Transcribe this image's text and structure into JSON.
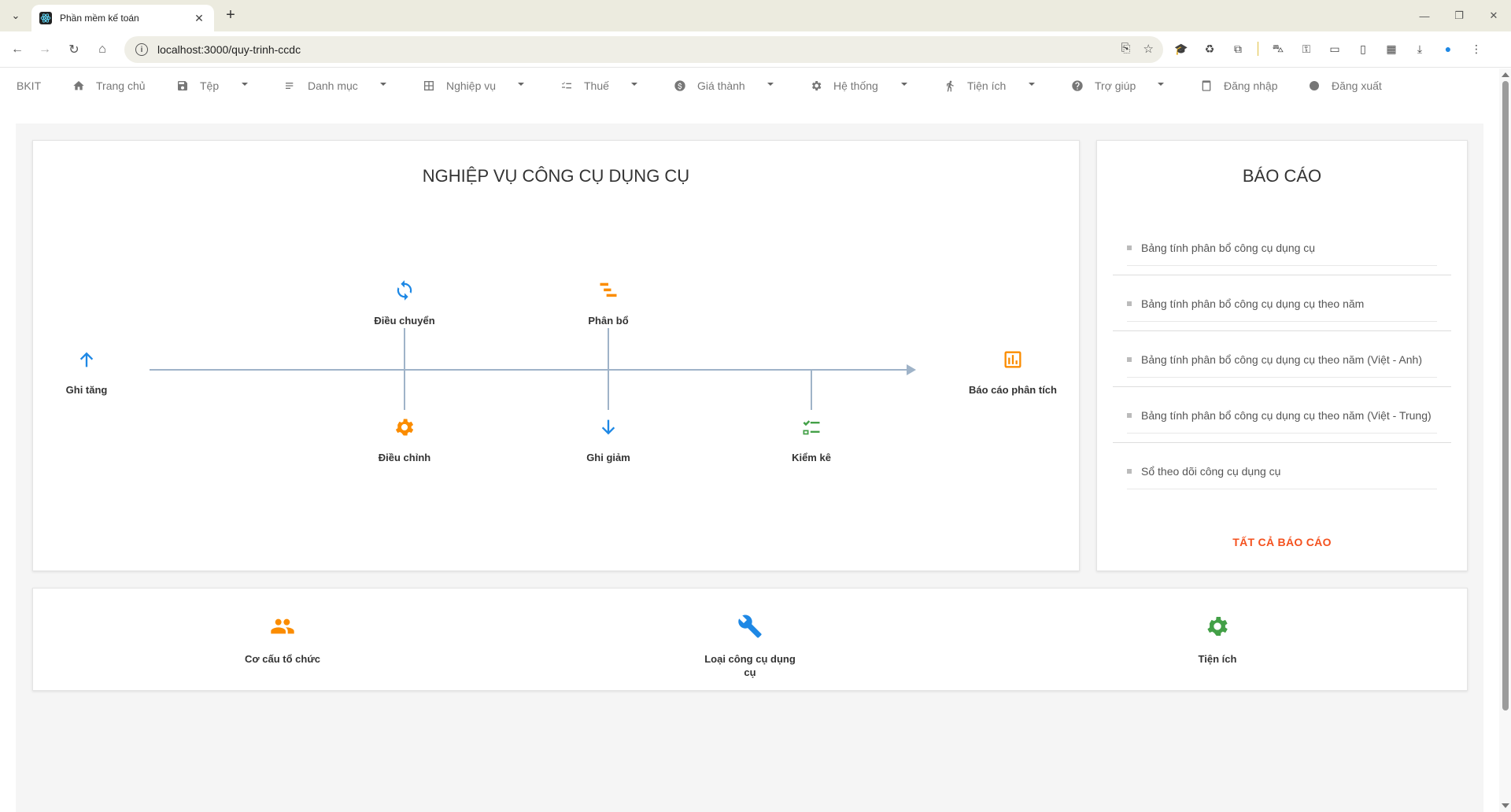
{
  "browser": {
    "tab_title": "Phần mềm kế toán",
    "url": "localhost:3000/quy-trinh-ccdc"
  },
  "menubar": {
    "brand": "BKIT",
    "items": [
      {
        "label": "Trang chủ",
        "icon": "home-icon"
      },
      {
        "label": "Tệp",
        "icon": "save-icon"
      },
      {
        "label": "Danh mục",
        "icon": "list-icon"
      },
      {
        "label": "Nghiệp vụ",
        "icon": "grid-icon"
      },
      {
        "label": "Thuế",
        "icon": "checklist-icon"
      },
      {
        "label": "Giá thành",
        "icon": "dollar-icon"
      },
      {
        "label": "Hệ thống",
        "icon": "gear-icon"
      },
      {
        "label": "Tiện ích",
        "icon": "runner-icon"
      },
      {
        "label": "Trợ giúp",
        "icon": "help-icon"
      },
      {
        "label": "Đăng nhập",
        "icon": "login-icon"
      },
      {
        "label": "Đăng xuất",
        "icon": "logout-icon"
      }
    ]
  },
  "workflow": {
    "title": "NGHIỆP VỤ CÔNG CỤ DỤNG CỤ",
    "start": "Ghi tăng",
    "end": "Báo cáo phân tích",
    "top_nodes": [
      "Điều chuyển",
      "Phân bổ"
    ],
    "bottom_nodes": [
      "Điều chỉnh",
      "Ghi giảm",
      "Kiểm kê"
    ]
  },
  "reports": {
    "title": "BÁO CÁO",
    "items": [
      "Bảng tính phân bổ công cụ dụng cụ",
      "Bảng tính phân bổ công cụ dụng cụ theo năm",
      "Bảng tính phân bổ công cụ dụng cụ theo năm (Việt - Anh)",
      "Bảng tính phân bổ công cụ dụng cụ theo năm (Việt - Trung)",
      "Sổ theo dõi công cụ dụng cụ"
    ],
    "all_label": "TẤT CẢ BÁO CÁO"
  },
  "shortcuts": [
    "Cơ cấu tổ chức",
    "Loại công cụ dụng cụ",
    "Tiện ích"
  ],
  "colors": {
    "blue": "#1e88e5",
    "orange": "#fb8c00",
    "green": "#43a047",
    "accent_red": "#f4511e",
    "line": "#9fb3c8"
  }
}
